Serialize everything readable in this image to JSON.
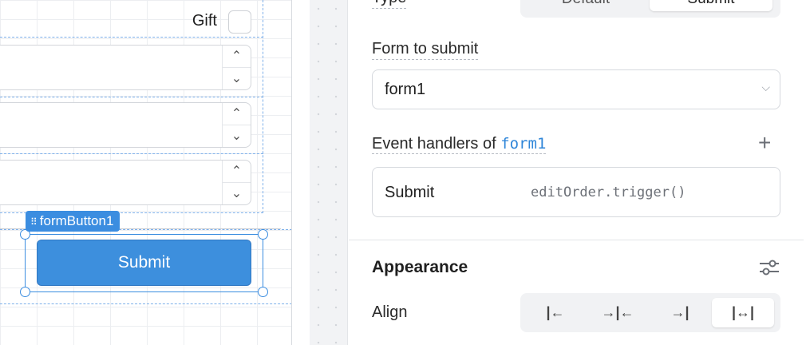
{
  "canvas": {
    "gift_label": "Gift",
    "stepper_up": "⌃",
    "stepper_down": "⌄",
    "selected_component": "formButton1",
    "grip": "⠿",
    "submit_button_label": "Submit",
    "selection_color": "#3b8de0"
  },
  "inspector": {
    "type_label": "Type",
    "type_options": [
      "Default",
      "Submit"
    ],
    "type_selected": "Submit",
    "form_to_submit_label": "Form to submit",
    "form_to_submit_value": "form1",
    "event_handlers_prefix": "Event handlers of",
    "event_handlers_target": "form1",
    "event_handlers_add": "+",
    "handler": {
      "event": "Submit",
      "action": "editOrder.trigger()"
    },
    "appearance_title": "Appearance",
    "align_label": "Align",
    "align_options": [
      "|←",
      "→|←",
      "→|",
      "|↔|"
    ],
    "align_option_names": [
      "align-left",
      "align-center",
      "align-right",
      "align-stretch"
    ],
    "align_selected": "align-stretch"
  }
}
